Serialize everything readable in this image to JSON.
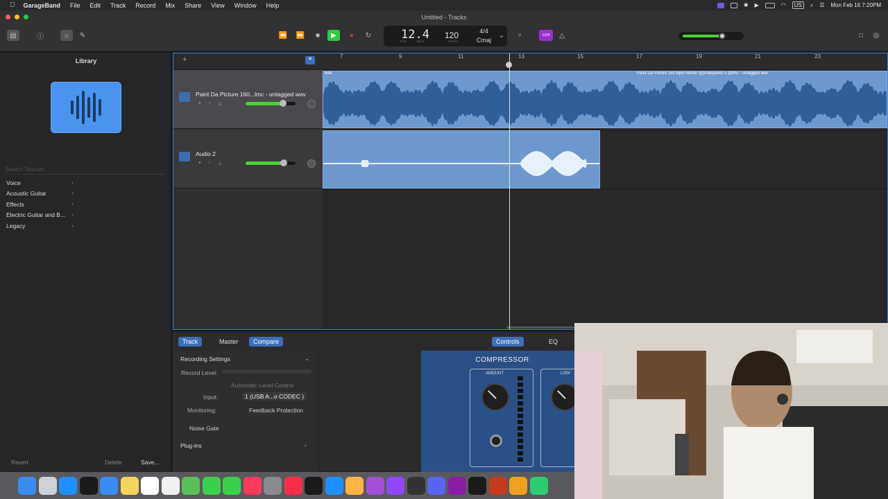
{
  "menubar": {
    "app_name": "GarageBand",
    "items": [
      "File",
      "Edit",
      "Track",
      "Record",
      "Mix",
      "Share",
      "View",
      "Window",
      "Help"
    ],
    "status_text": "US",
    "clock": "Mon Feb 16  7:20PM"
  },
  "window": {
    "title": "Untitled - Tracks"
  },
  "transport": {
    "position": "12.4",
    "position_sub_bar": "BAR",
    "position_sub_beat": "BEAT",
    "tempo": "120",
    "tempo_sub": "TEMPO",
    "time_signature": "4/4",
    "key": "Cmaj",
    "count_in": "1234"
  },
  "library": {
    "title": "Library",
    "search_placeholder": "Search Sounds",
    "categories": [
      "Voice",
      "Acoustic Guitar",
      "Effects",
      "Electric Guitar and B...",
      "Legacy"
    ],
    "revert": "Revert",
    "delete": "Delete",
    "save": "Save..."
  },
  "ruler": {
    "bars": [
      "7",
      "9",
      "11",
      "13",
      "15",
      "17",
      "19",
      "21",
      "23"
    ]
  },
  "tracks": [
    {
      "name": "Paint Da Picture 160...lmc - untagged wav",
      "volume": 0.75,
      "region_title_left": "wav",
      "region_title_right": "Paint Da Picture 160 Bpm Abmin @prodayteez x @lmc - untagged wav"
    },
    {
      "name": "Audio 2",
      "volume": 0.77
    }
  ],
  "editor": {
    "tabs": [
      "Track",
      "Master",
      "Compare"
    ],
    "right_tabs": [
      "Controls",
      "EQ"
    ],
    "recording_settings": "Recording Settings",
    "record_level": "Record Level:",
    "auto_level": "Automatic Level Control",
    "input_label": "Input:",
    "input_value": "1 (USB A...o CODEC )",
    "monitoring_label": "Monitoring:",
    "feedback_protection": "Feedback Protection",
    "noise_gate": "Noise Gate",
    "plugins": "Plug-ins",
    "compressor_title": "COMPRESSOR",
    "amount_label": "AMOUNT",
    "low_label": "LOW"
  },
  "dock_icons": [
    "finder-icon",
    "launchpad-icon",
    "safari-icon",
    "chrome-icon",
    "mail-icon",
    "notes-icon",
    "calendar-icon",
    "reminders-icon",
    "maps-icon",
    "messages-icon",
    "facetime-icon",
    "news-icon",
    "settings-icon",
    "music-icon",
    "tv-icon",
    "appstore-icon",
    "photos-icon",
    "podcasts-icon",
    "twitch-icon",
    "finalcut-icon",
    "discord-icon",
    "onenote-icon",
    "terminal-icon",
    "app-icon",
    "app-icon",
    "app-icon"
  ],
  "colors": {
    "accent": "#3d6fb8",
    "region": "#6d99cf",
    "meter": "#4cd137"
  }
}
